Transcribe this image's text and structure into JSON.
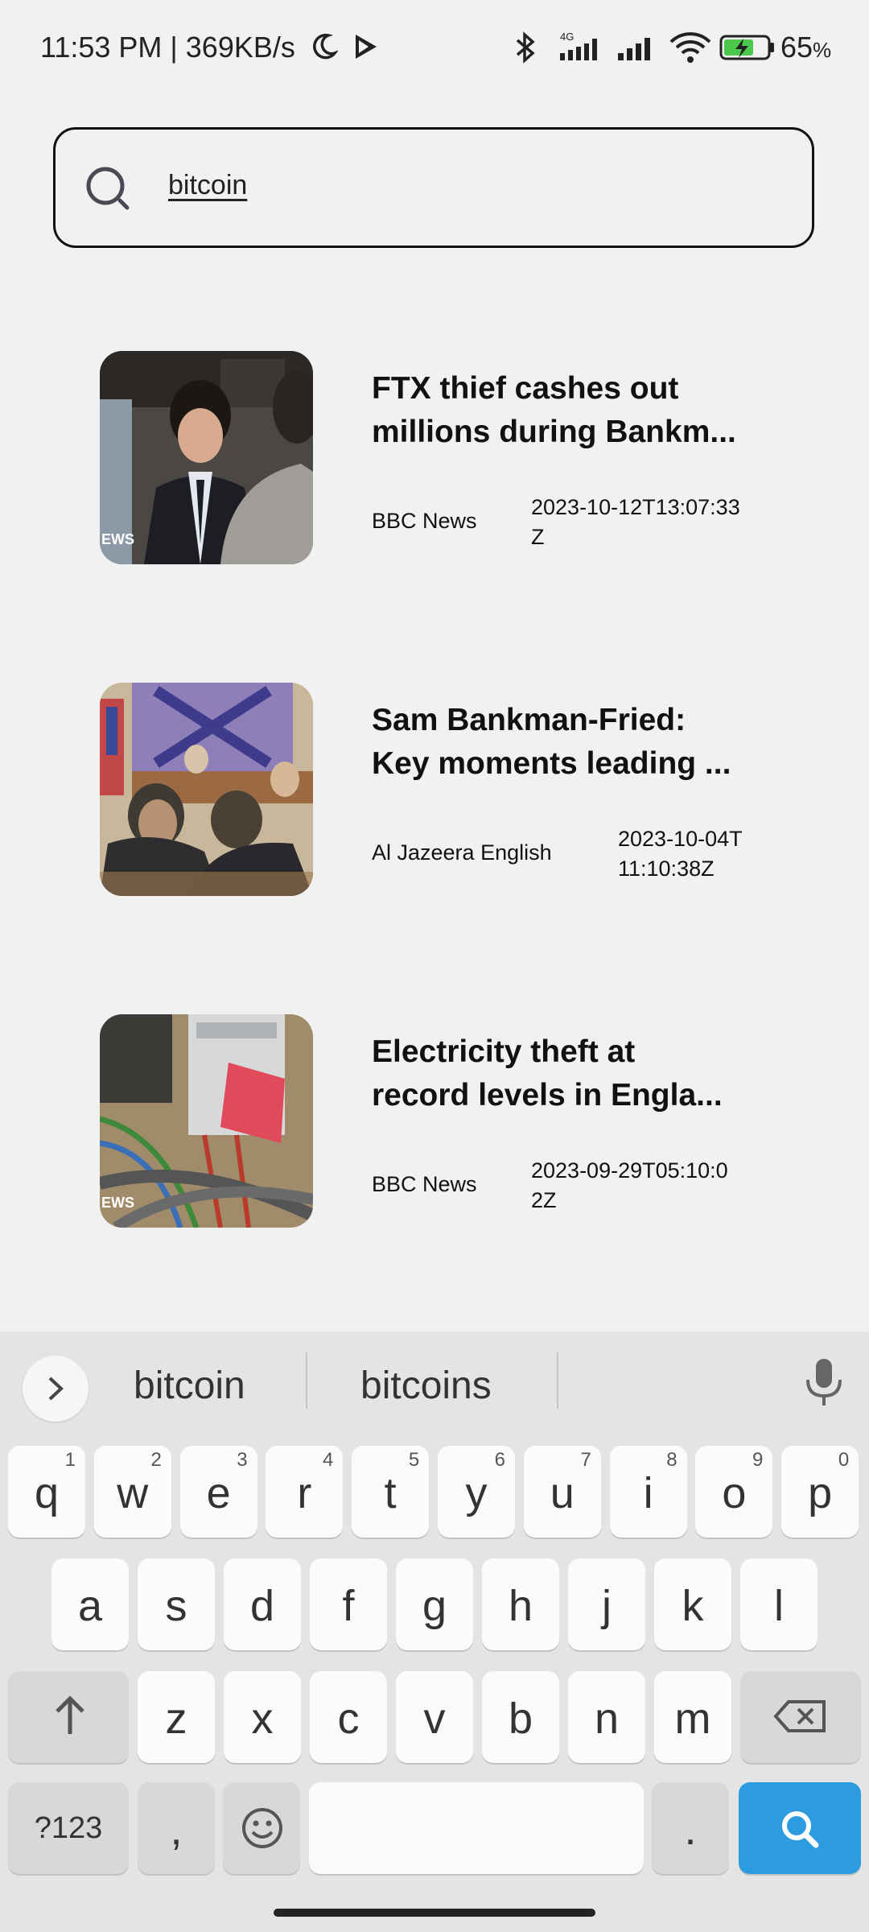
{
  "status_bar": {
    "time_speed": "11:53 PM | 369KB/s",
    "network_label": "4G",
    "battery_percent": "65",
    "battery_unit": "%",
    "icons": [
      "moon-icon",
      "play-store-icon",
      "bluetooth-icon",
      "signal-icon",
      "wifi-icon",
      "battery-icon"
    ]
  },
  "search": {
    "query": "bitcoin",
    "icon": "search-icon"
  },
  "articles": [
    {
      "title_line1": "FTX thief cashes out",
      "title_line2": "millions during Bankm...",
      "source": "BBC News",
      "date_line1": "2023-10-12T13:07:33",
      "date_line2": "Z",
      "thumb_watermark": "EWS"
    },
    {
      "title_line1": "Sam Bankman-Fried:",
      "title_line2": "Key moments leading ...",
      "source": "Al Jazeera English",
      "date_line1": "2023-10-04T",
      "date_line2": "11:10:38Z"
    },
    {
      "title_line1": "Electricity theft at",
      "title_line2": "record levels in Engla...",
      "source": "BBC News",
      "date_line1": "2023-09-29T05:10:0",
      "date_line2": "2Z",
      "thumb_watermark": "EWS"
    }
  ],
  "keyboard": {
    "suggestions": [
      "bitcoin",
      "bitcoins"
    ],
    "row1": [
      {
        "k": "q",
        "h": "1"
      },
      {
        "k": "w",
        "h": "2"
      },
      {
        "k": "e",
        "h": "3"
      },
      {
        "k": "r",
        "h": "4"
      },
      {
        "k": "t",
        "h": "5"
      },
      {
        "k": "y",
        "h": "6"
      },
      {
        "k": "u",
        "h": "7"
      },
      {
        "k": "i",
        "h": "8"
      },
      {
        "k": "o",
        "h": "9"
      },
      {
        "k": "p",
        "h": "0"
      }
    ],
    "row2": [
      "a",
      "s",
      "d",
      "f",
      "g",
      "h",
      "j",
      "k",
      "l"
    ],
    "row3": [
      "z",
      "x",
      "c",
      "v",
      "b",
      "n",
      "m"
    ],
    "symbols_label": "?123",
    "comma_label": ",",
    "period_label": ".",
    "accent_color": "#2d9be0"
  }
}
